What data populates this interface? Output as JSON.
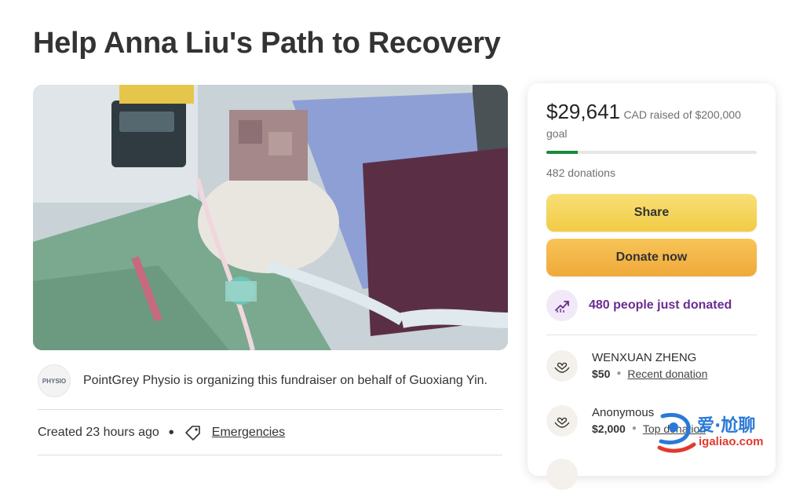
{
  "page": {
    "title": "Help Anna Liu's Path to Recovery"
  },
  "organizer": {
    "logo_text": "PHYSIO",
    "text": "PointGrey Physio is organizing this fundraiser on behalf of Guoxiang Yin."
  },
  "meta": {
    "created": "Created 23 hours ago",
    "separator": "•",
    "category": "Emergencies"
  },
  "panel": {
    "amount": "$29,641",
    "raised_text": "CAD raised of $200,000",
    "goal_text": "goal",
    "progress_fraction": 0.148,
    "donations": "482 donations",
    "share_label": "Share",
    "donate_label": "Donate now",
    "just_donated": "480 people just donated",
    "donors": [
      {
        "name": "WENXUAN ZHENG",
        "amount": "$50",
        "tag": "Recent donation"
      },
      {
        "name": "Anonymous",
        "amount": "$2,000",
        "tag": "Top donation"
      }
    ]
  },
  "watermark": {
    "cn": "爱·尬聊",
    "en": "igaliao.com"
  },
  "colors": {
    "share_yellow": "#f2cb45",
    "donate_orange": "#f0a93a",
    "progress_green": "#1a8a3c",
    "accent_purple": "#6a2c91"
  }
}
